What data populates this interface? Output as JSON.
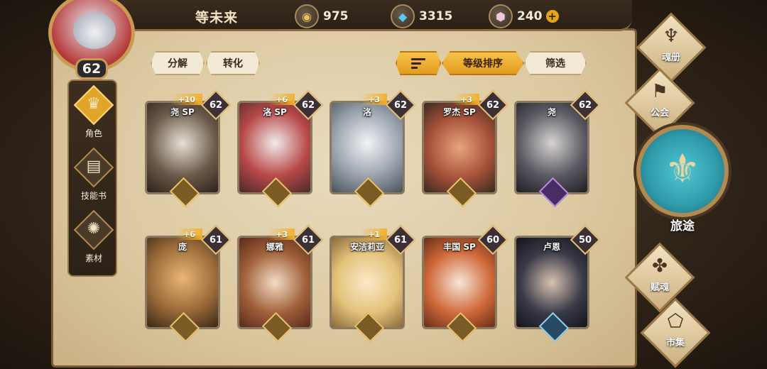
{
  "player": {
    "name": "等未来",
    "level": "62"
  },
  "resources": [
    {
      "icon": "gold-coin-icon",
      "value": "975"
    },
    {
      "icon": "blue-crystal-icon",
      "value": "3315"
    },
    {
      "icon": "pink-gem-icon",
      "value": "240",
      "plus": "+"
    }
  ],
  "sidenav": [
    {
      "label": "角色",
      "icon": "character-icon",
      "active": true
    },
    {
      "label": "技能书",
      "icon": "skill-book-icon",
      "active": false
    },
    {
      "label": "素材",
      "icon": "material-icon",
      "active": false
    }
  ],
  "actions": {
    "decompose": "分解",
    "convert": "转化",
    "sort_level": "等级排序",
    "filter": "筛选"
  },
  "cards": [
    {
      "name": "尧 SP",
      "level": "62",
      "plus": "+10",
      "crest": "gold"
    },
    {
      "name": "洛 SP",
      "level": "62",
      "plus": "+6",
      "crest": "gold"
    },
    {
      "name": "洛",
      "level": "62",
      "plus": "+3",
      "crest": "gold"
    },
    {
      "name": "罗杰 SP",
      "level": "62",
      "plus": "+3",
      "crest": "gold"
    },
    {
      "name": "尧",
      "level": "62",
      "plus": "",
      "crest": "purple"
    },
    {
      "name": "庞",
      "level": "61",
      "plus": "+6",
      "crest": "gold"
    },
    {
      "name": "娜雅",
      "level": "61",
      "plus": "+3",
      "crest": "gold"
    },
    {
      "name": "安洁莉亚",
      "level": "61",
      "plus": "+1",
      "crest": "gold"
    },
    {
      "name": "丰国 SP",
      "level": "60",
      "plus": "",
      "crest": "gold"
    },
    {
      "name": "卢恩",
      "level": "50",
      "plus": "",
      "crest": "blue"
    }
  ],
  "rightnav": {
    "soul_book": "魂册",
    "guild": "公会",
    "journey": "旅途",
    "endow": "赋魂",
    "market": "市集"
  }
}
